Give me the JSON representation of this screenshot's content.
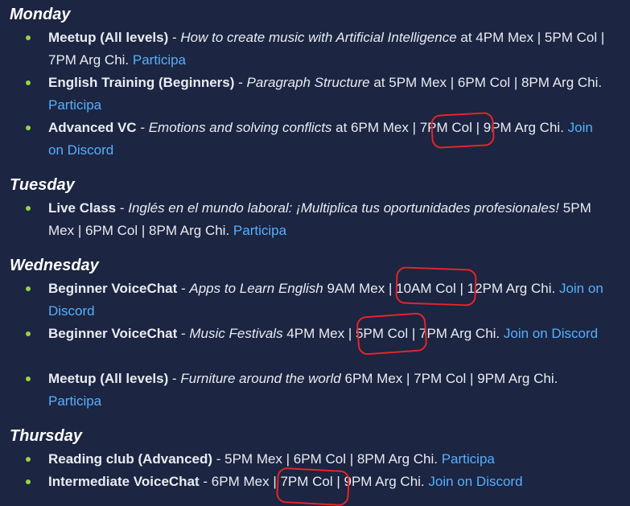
{
  "monday": {
    "label": "Monday",
    "items": [
      {
        "name": "Meetup (All levels)",
        "dash": " - ",
        "topic": "How to create music with Artificial Intelligence",
        "times": " at 4PM Mex | 5PM Col | 7PM Arg Chi. ",
        "link": "Participa"
      },
      {
        "name": "English Training (Beginners)",
        "dash": " - ",
        "topic": "Paragraph Structure",
        "times": " at 5PM Mex | 6PM Col | 8PM Arg Chi. ",
        "link": "Participa"
      },
      {
        "name": "Advanced VC",
        "dash": " - ",
        "topic": "Emotions and solving conflicts",
        "times": " at 6PM Mex | 7PM Col | 9PM Arg Chi. ",
        "link": "Join on Discord"
      }
    ]
  },
  "tuesday": {
    "label": "Tuesday",
    "items": [
      {
        "name": "Live Class",
        "dash": " - ",
        "topic": "Inglés en el mundo laboral: ¡Multiplica tus oportunidades profesionales!",
        "times": " 5PM Mex | 6PM Col | 8PM Arg Chi. ",
        "link": "Participa"
      }
    ]
  },
  "wednesday": {
    "label": "Wednesday",
    "items": [
      {
        "name": "Beginner VoiceChat",
        "dash": " - ",
        "topic": "Apps to Learn English",
        "times": " 9AM Mex | 10AM Col | 12PM Arg Chi. ",
        "link": "Join on Discord"
      },
      {
        "name": "Beginner VoiceChat",
        "dash": " - ",
        "topic": "Music Festivals",
        "times": " 4PM Mex | 5PM Col | 7PM Arg Chi. ",
        "link": "Join on Discord"
      },
      {
        "name": "Meetup (All levels)",
        "dash": " - ",
        "topic": "Furniture around the world",
        "times": " 6PM Mex | 7PM Col | 9PM Arg Chi. ",
        "link": "Participa"
      }
    ]
  },
  "thursday": {
    "label": "Thursday",
    "items": [
      {
        "name": "Reading club (Advanced)",
        "dash": " - ",
        "topic": "",
        "times": "5PM Mex | 6PM Col | 8PM Arg Chi. ",
        "link": "Participa"
      },
      {
        "name": "Intermediate VoiceChat",
        "dash": " - ",
        "topic": "",
        "times": "6PM Mex | 7PM Col | 9PM Arg Chi. ",
        "link": "Join on Discord"
      }
    ]
  },
  "colors": {
    "background": "#1c2541",
    "text": "#e9ecf3",
    "link": "#55b0ff",
    "bullet": "#9bd14a",
    "annotation": "#e4252b"
  }
}
